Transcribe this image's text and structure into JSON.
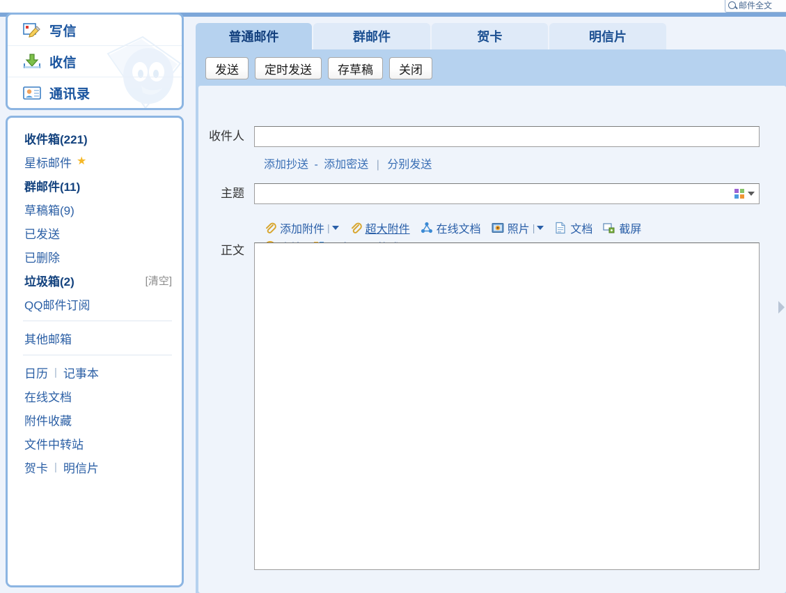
{
  "search": {
    "placeholder": "邮件全文",
    "icon": "search-icon"
  },
  "sidebar": {
    "nav": [
      {
        "label": "写信",
        "icon": "compose-pencil-icon"
      },
      {
        "label": "收信",
        "icon": "inbox-download-icon"
      },
      {
        "label": "通讯录",
        "icon": "contacts-card-icon"
      }
    ],
    "folders": [
      {
        "label": "收件箱(221)",
        "bold": true,
        "star": false,
        "action": ""
      },
      {
        "label": "星标邮件",
        "bold": false,
        "star": true,
        "action": ""
      },
      {
        "label": "群邮件(11)",
        "bold": true,
        "star": false,
        "action": ""
      },
      {
        "label": "草稿箱(9)",
        "bold": false,
        "star": false,
        "action": ""
      },
      {
        "label": "已发送",
        "bold": false,
        "star": false,
        "action": ""
      },
      {
        "label": "已删除",
        "bold": false,
        "star": false,
        "action": ""
      },
      {
        "label": "垃圾箱(2)",
        "bold": true,
        "star": false,
        "action": "[清空]"
      },
      {
        "label": "QQ邮件订阅",
        "bold": false,
        "star": false,
        "action": ""
      }
    ],
    "other_mailbox": "其他邮箱",
    "tools": [
      {
        "items": [
          "日历",
          "记事本"
        ]
      },
      {
        "items": [
          "在线文档"
        ]
      },
      {
        "items": [
          "附件收藏"
        ]
      },
      {
        "items": [
          "文件中转站"
        ]
      },
      {
        "items": [
          "贺卡",
          "明信片"
        ]
      }
    ],
    "divider": "|"
  },
  "main": {
    "tabs": [
      {
        "label": "普通邮件",
        "active": true
      },
      {
        "label": "群邮件",
        "active": false
      },
      {
        "label": "贺卡",
        "active": false
      },
      {
        "label": "明信片",
        "active": false
      }
    ],
    "actions": [
      {
        "label": "发送"
      },
      {
        "label": "定时发送"
      },
      {
        "label": "存草稿"
      },
      {
        "label": "关闭"
      }
    ],
    "form": {
      "to_label": "收件人",
      "to_value": "",
      "to_placeholder": "",
      "cc_add": "添加抄送",
      "cc_dash": "-",
      "bcc_add": "添加密送",
      "cc_bar": "|",
      "separate_send": "分别发送",
      "subject_label": "主题",
      "subject_value": "",
      "subject_placeholder": "",
      "subject_color_icon": "color-palette-icon",
      "body_label": "正文",
      "body_value": ""
    },
    "attachments": {
      "row1": [
        {
          "label": "添加附件",
          "icon": "paperclip-icon",
          "dropdown": true,
          "underline": false
        },
        {
          "label": "超大附件",
          "icon": "paperclip-icon",
          "dropdown": false,
          "underline": true
        },
        {
          "label": "在线文档",
          "icon": "share-nodes-icon",
          "dropdown": false,
          "underline": false
        },
        {
          "label": "照片",
          "icon": "photo-icon",
          "dropdown": true,
          "underline": false
        },
        {
          "label": "文档",
          "icon": "document-icon",
          "dropdown": false,
          "underline": false
        },
        {
          "label": "截屏",
          "icon": "screenshot-icon",
          "dropdown": false,
          "underline": false
        }
      ],
      "row2": [
        {
          "label": "表情",
          "icon": "smiley-icon",
          "dropdown": false,
          "underline": false
        },
        {
          "label": "更多",
          "icon": "grid-squares-icon",
          "dropdown": false,
          "underline": false
        },
        {
          "label": "格式↓",
          "icon": "font-letter-icon",
          "dropdown": false,
          "underline": false
        }
      ]
    }
  },
  "colors": {
    "accent_blue": "#2b5fa5",
    "panel_border": "#8cb5e2",
    "tab_active": "#b6d2ef",
    "tab_inactive": "#dfeaf8",
    "page_bg": "#eef3fb"
  }
}
